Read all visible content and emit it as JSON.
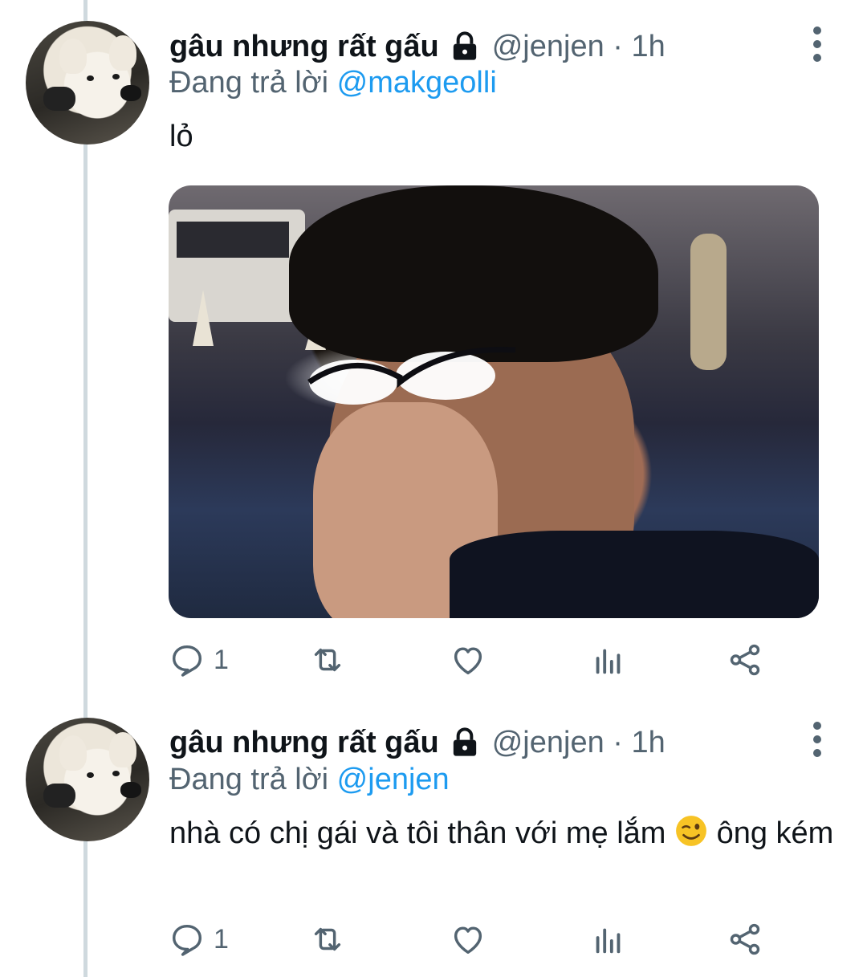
{
  "tweets": [
    {
      "display_name": "gâu nhưng rất gấu",
      "handle_time": "@jenjen · 1h",
      "reply_prefix": "Đang trả lời",
      "reply_mention": "@makgeolli",
      "text": "lỏ",
      "has_media": true,
      "reply_count": "1"
    },
    {
      "display_name": "gâu nhưng rất gấu",
      "handle_time": "@jenjen · 1h",
      "reply_prefix": "Đang trả lời",
      "reply_mention": "@jenjen",
      "text_before_emoji": "nhà có chị gái và tôi thân với mẹ lắm",
      "text_after_emoji": "ông kém",
      "emoji": "winking-face",
      "has_media": false,
      "reply_count": "1"
    }
  ],
  "icons": {
    "lock": "lock-icon",
    "more": "more-vertical-icon",
    "reply": "reply-icon",
    "retweet": "retweet-icon",
    "like": "heart-icon",
    "views": "analytics-icon",
    "share": "share-icon"
  },
  "colors": {
    "link": "#1d9bf0",
    "secondary_text": "#536471",
    "thread_line": "#cfd9de"
  }
}
